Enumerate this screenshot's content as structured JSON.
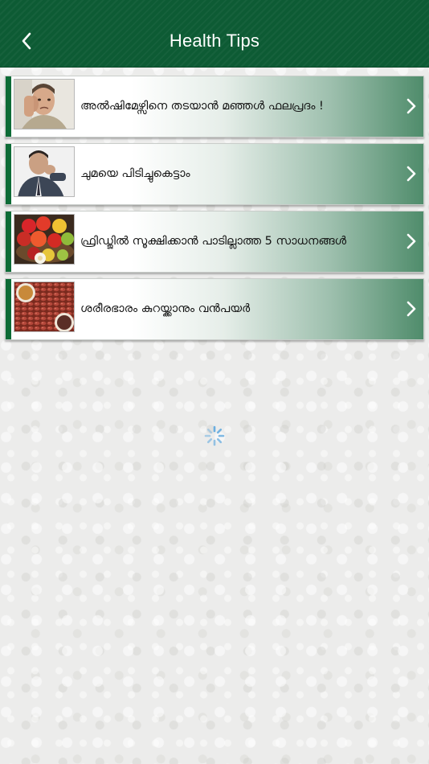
{
  "header": {
    "title": "Health Tips",
    "back_icon": "chevron-left-icon"
  },
  "colors": {
    "nav_bg": "#0d5b34",
    "accent": "#0d6b36",
    "spinner": "#6aaee0"
  },
  "tips": [
    {
      "title": "അൽഷിമേഴ്സിനെ തടയാൻ മഞ്ഞൾ ഫലപ്രദം !",
      "thumbnail": "man-headache-photo"
    },
    {
      "title": "ചുമയെ പിടിച്ചുകെട്ടാം",
      "thumbnail": "man-coughing-photo"
    },
    {
      "title": "ഫ്രിഡ്ജിൽ സൂക്ഷിക്കാൻ പാടില്ലാത്ത 5 സാധനങ്ങൾ",
      "thumbnail": "fruit-basket-photo"
    },
    {
      "title": "ശരീരഭാരം കുറയ്ക്കാനും വൻപയർ",
      "thumbnail": "kidney-beans-photo"
    }
  ],
  "loading_icon": "loading-spinner-icon"
}
